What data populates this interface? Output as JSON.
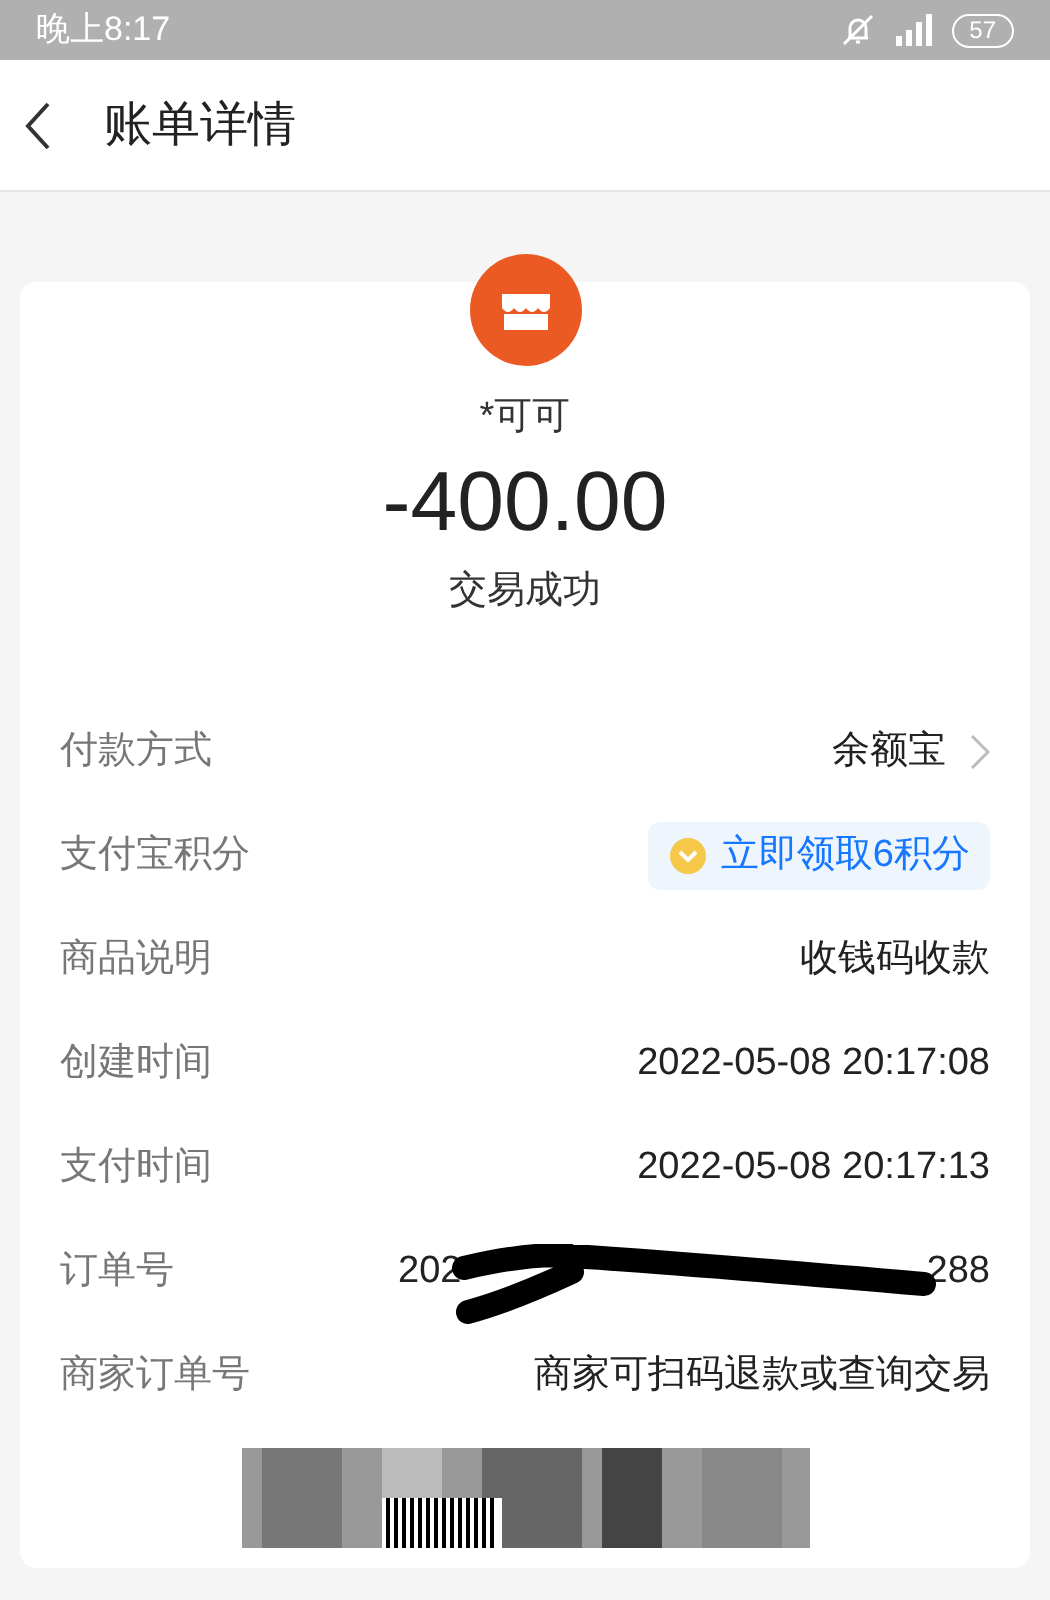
{
  "status_bar": {
    "time": "晚上8:17",
    "battery": "57"
  },
  "header": {
    "title": "账单详情"
  },
  "summary": {
    "merchant": "*可可",
    "amount": "-400.00",
    "status": "交易成功"
  },
  "rows": [
    {
      "kind": "link",
      "label": "付款方式",
      "value": "余额宝"
    },
    {
      "kind": "points",
      "label": "支付宝积分",
      "value": "立即领取6积分"
    },
    {
      "kind": "plain",
      "label": "商品说明",
      "value": "收钱码收款"
    },
    {
      "kind": "plain",
      "label": "创建时间",
      "value": "2022-05-08 20:17:08"
    },
    {
      "kind": "plain",
      "label": "支付时间",
      "value": "2022-05-08 20:17:13"
    },
    {
      "kind": "redacted",
      "label": "订单号",
      "value_start": "202",
      "value_end": "288"
    },
    {
      "kind": "plain",
      "label": "商家订单号",
      "value": "商家可扫码退款或查询交易"
    }
  ]
}
